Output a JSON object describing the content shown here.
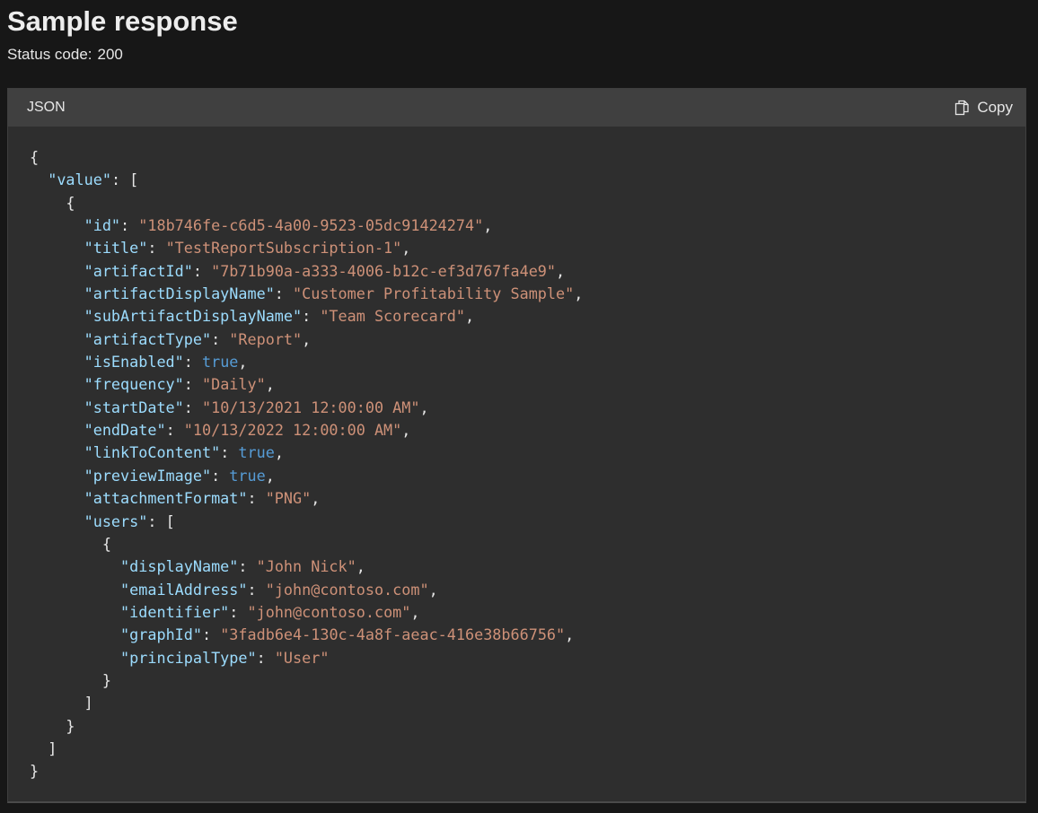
{
  "page": {
    "title": "Sample response",
    "status_label": "Status code:",
    "status_value": "200"
  },
  "code_block": {
    "language": "JSON",
    "copy_label": "Copy",
    "copy_icon": "copy-icon",
    "colors": {
      "key": "#9cdcfe",
      "string": "#ce9178",
      "boolean": "#569cd6",
      "punctuation": "#e6e6e6",
      "background": "#2e2e2e",
      "header": "#404040"
    },
    "lines": [
      [
        {
          "t": "p",
          "v": "{"
        }
      ],
      [
        {
          "t": "p",
          "v": "  "
        },
        {
          "t": "k",
          "v": "\"value\""
        },
        {
          "t": "p",
          "v": ": ["
        }
      ],
      [
        {
          "t": "p",
          "v": "    {"
        }
      ],
      [
        {
          "t": "p",
          "v": "      "
        },
        {
          "t": "k",
          "v": "\"id\""
        },
        {
          "t": "p",
          "v": ": "
        },
        {
          "t": "s",
          "v": "\"18b746fe-c6d5-4a00-9523-05dc91424274\""
        },
        {
          "t": "p",
          "v": ","
        }
      ],
      [
        {
          "t": "p",
          "v": "      "
        },
        {
          "t": "k",
          "v": "\"title\""
        },
        {
          "t": "p",
          "v": ": "
        },
        {
          "t": "s",
          "v": "\"TestReportSubscription-1\""
        },
        {
          "t": "p",
          "v": ","
        }
      ],
      [
        {
          "t": "p",
          "v": "      "
        },
        {
          "t": "k",
          "v": "\"artifactId\""
        },
        {
          "t": "p",
          "v": ": "
        },
        {
          "t": "s",
          "v": "\"7b71b90a-a333-4006-b12c-ef3d767fa4e9\""
        },
        {
          "t": "p",
          "v": ","
        }
      ],
      [
        {
          "t": "p",
          "v": "      "
        },
        {
          "t": "k",
          "v": "\"artifactDisplayName\""
        },
        {
          "t": "p",
          "v": ": "
        },
        {
          "t": "s",
          "v": "\"Customer Profitability Sample\""
        },
        {
          "t": "p",
          "v": ","
        }
      ],
      [
        {
          "t": "p",
          "v": "      "
        },
        {
          "t": "k",
          "v": "\"subArtifactDisplayName\""
        },
        {
          "t": "p",
          "v": ": "
        },
        {
          "t": "s",
          "v": "\"Team Scorecard\""
        },
        {
          "t": "p",
          "v": ","
        }
      ],
      [
        {
          "t": "p",
          "v": "      "
        },
        {
          "t": "k",
          "v": "\"artifactType\""
        },
        {
          "t": "p",
          "v": ": "
        },
        {
          "t": "s",
          "v": "\"Report\""
        },
        {
          "t": "p",
          "v": ","
        }
      ],
      [
        {
          "t": "p",
          "v": "      "
        },
        {
          "t": "k",
          "v": "\"isEnabled\""
        },
        {
          "t": "p",
          "v": ": "
        },
        {
          "t": "b",
          "v": "true"
        },
        {
          "t": "p",
          "v": ","
        }
      ],
      [
        {
          "t": "p",
          "v": "      "
        },
        {
          "t": "k",
          "v": "\"frequency\""
        },
        {
          "t": "p",
          "v": ": "
        },
        {
          "t": "s",
          "v": "\"Daily\""
        },
        {
          "t": "p",
          "v": ","
        }
      ],
      [
        {
          "t": "p",
          "v": "      "
        },
        {
          "t": "k",
          "v": "\"startDate\""
        },
        {
          "t": "p",
          "v": ": "
        },
        {
          "t": "s",
          "v": "\"10/13/2021 12:00:00 AM\""
        },
        {
          "t": "p",
          "v": ","
        }
      ],
      [
        {
          "t": "p",
          "v": "      "
        },
        {
          "t": "k",
          "v": "\"endDate\""
        },
        {
          "t": "p",
          "v": ": "
        },
        {
          "t": "s",
          "v": "\"10/13/2022 12:00:00 AM\""
        },
        {
          "t": "p",
          "v": ","
        }
      ],
      [
        {
          "t": "p",
          "v": "      "
        },
        {
          "t": "k",
          "v": "\"linkToContent\""
        },
        {
          "t": "p",
          "v": ": "
        },
        {
          "t": "b",
          "v": "true"
        },
        {
          "t": "p",
          "v": ","
        }
      ],
      [
        {
          "t": "p",
          "v": "      "
        },
        {
          "t": "k",
          "v": "\"previewImage\""
        },
        {
          "t": "p",
          "v": ": "
        },
        {
          "t": "b",
          "v": "true"
        },
        {
          "t": "p",
          "v": ","
        }
      ],
      [
        {
          "t": "p",
          "v": "      "
        },
        {
          "t": "k",
          "v": "\"attachmentFormat\""
        },
        {
          "t": "p",
          "v": ": "
        },
        {
          "t": "s",
          "v": "\"PNG\""
        },
        {
          "t": "p",
          "v": ","
        }
      ],
      [
        {
          "t": "p",
          "v": "      "
        },
        {
          "t": "k",
          "v": "\"users\""
        },
        {
          "t": "p",
          "v": ": ["
        }
      ],
      [
        {
          "t": "p",
          "v": "        {"
        }
      ],
      [
        {
          "t": "p",
          "v": "          "
        },
        {
          "t": "k",
          "v": "\"displayName\""
        },
        {
          "t": "p",
          "v": ": "
        },
        {
          "t": "s",
          "v": "\"John Nick\""
        },
        {
          "t": "p",
          "v": ","
        }
      ],
      [
        {
          "t": "p",
          "v": "          "
        },
        {
          "t": "k",
          "v": "\"emailAddress\""
        },
        {
          "t": "p",
          "v": ": "
        },
        {
          "t": "s",
          "v": "\"john@contoso.com\""
        },
        {
          "t": "p",
          "v": ","
        }
      ],
      [
        {
          "t": "p",
          "v": "          "
        },
        {
          "t": "k",
          "v": "\"identifier\""
        },
        {
          "t": "p",
          "v": ": "
        },
        {
          "t": "s",
          "v": "\"john@contoso.com\""
        },
        {
          "t": "p",
          "v": ","
        }
      ],
      [
        {
          "t": "p",
          "v": "          "
        },
        {
          "t": "k",
          "v": "\"graphId\""
        },
        {
          "t": "p",
          "v": ": "
        },
        {
          "t": "s",
          "v": "\"3fadb6e4-130c-4a8f-aeac-416e38b66756\""
        },
        {
          "t": "p",
          "v": ","
        }
      ],
      [
        {
          "t": "p",
          "v": "          "
        },
        {
          "t": "k",
          "v": "\"principalType\""
        },
        {
          "t": "p",
          "v": ": "
        },
        {
          "t": "s",
          "v": "\"User\""
        }
      ],
      [
        {
          "t": "p",
          "v": "        }"
        }
      ],
      [
        {
          "t": "p",
          "v": "      ]"
        }
      ],
      [
        {
          "t": "p",
          "v": "    }"
        }
      ],
      [
        {
          "t": "p",
          "v": "  ]"
        }
      ],
      [
        {
          "t": "p",
          "v": "}"
        }
      ]
    ]
  }
}
